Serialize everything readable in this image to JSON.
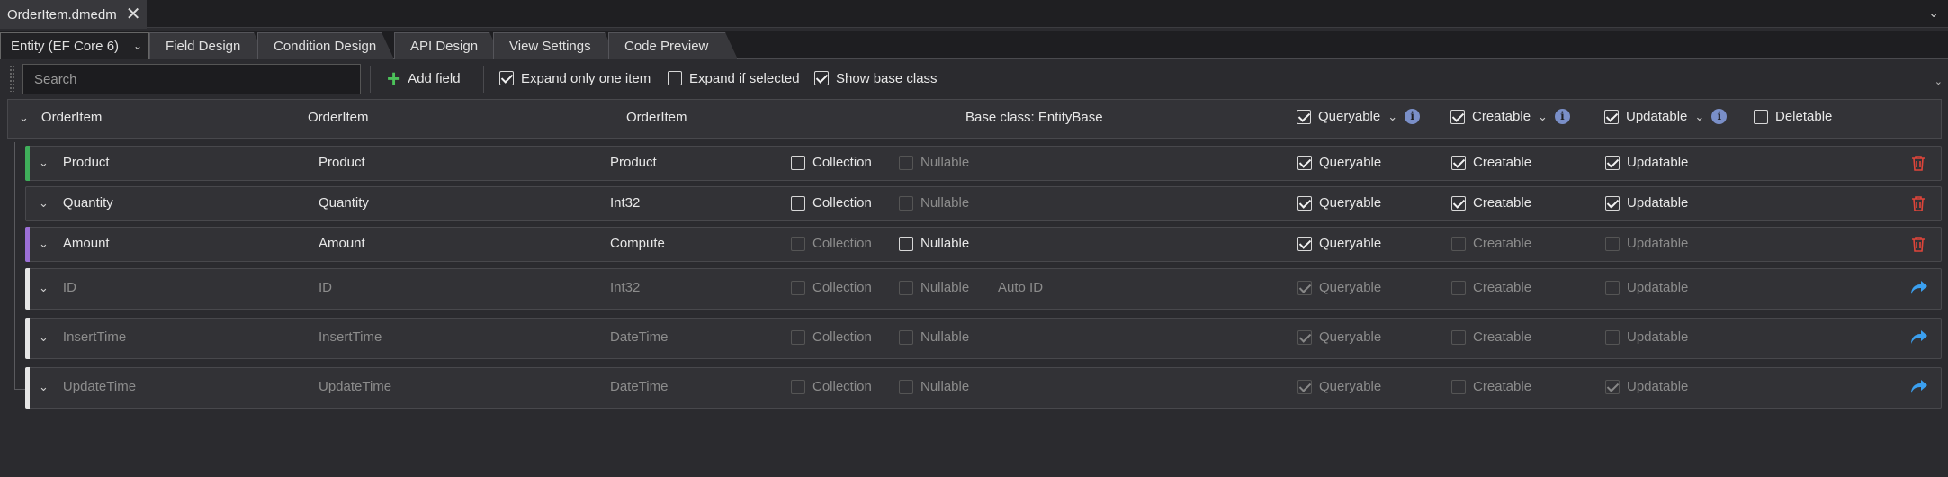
{
  "document_tab": {
    "title": "OrderItem.dmedm",
    "close_icon": "close-icon"
  },
  "tabs": [
    {
      "label": "Entity (EF Core 6)",
      "dropdown": "chevron-down-icon",
      "active": true
    },
    {
      "label": "Field Design"
    },
    {
      "label": "Condition Design"
    },
    {
      "label": "API Design"
    },
    {
      "label": "View Settings"
    },
    {
      "label": "Code Preview"
    }
  ],
  "toolbar": {
    "search_placeholder": "Search",
    "add_field_label": "Add field",
    "expand_only_one_label": "Expand only one item",
    "expand_only_one_checked": true,
    "expand_if_selected_label": "Expand if selected",
    "expand_if_selected_checked": false,
    "show_base_class_label": "Show base class",
    "show_base_class_checked": true
  },
  "entity": {
    "name": "OrderItem",
    "display_name": "OrderItem",
    "table_name": "OrderItem",
    "base_class_text": "Base class: EntityBase",
    "queryable_label": "Queryable",
    "creatable_label": "Creatable",
    "updatable_label": "Updatable",
    "deletable_label": "Deletable"
  },
  "labels": {
    "collection": "Collection",
    "nullable": "Nullable",
    "queryable": "Queryable",
    "creatable": "Creatable",
    "updatable": "Updatable"
  },
  "fields": [
    {
      "name": "Product",
      "display": "Product",
      "type": "Product",
      "stripe": "#3fae5a",
      "dim": false,
      "extra": "",
      "collection": false,
      "nullable": false,
      "nullable_enabled": false,
      "queryable": true,
      "creatable": true,
      "updatable": true,
      "creatable_enabled": true,
      "updatable_enabled": true,
      "action": "trash-icon"
    },
    {
      "name": "Quantity",
      "display": "Quantity",
      "type": "Int32",
      "stripe": "",
      "dim": false,
      "extra": "",
      "collection": false,
      "nullable": false,
      "nullable_enabled": false,
      "queryable": true,
      "creatable": true,
      "updatable": true,
      "creatable_enabled": true,
      "updatable_enabled": true,
      "action": "trash-icon"
    },
    {
      "name": "Amount",
      "display": "Amount",
      "type": "Compute",
      "stripe": "#9b6fd6",
      "dim": false,
      "extra": "",
      "collection": false,
      "collection_enabled": false,
      "nullable": false,
      "nullable_enabled": true,
      "queryable": true,
      "creatable": false,
      "updatable": false,
      "creatable_enabled": false,
      "updatable_enabled": false,
      "action": "trash-icon"
    },
    {
      "name": "ID",
      "display": "ID",
      "type": "Int32",
      "stripe": "#e6e6e6",
      "dim": true,
      "extra": "Auto ID",
      "collection": false,
      "nullable": false,
      "queryable": true,
      "creatable": false,
      "updatable": false,
      "action": "forward-icon"
    },
    {
      "name": "InsertTime",
      "display": "InsertTime",
      "type": "DateTime",
      "stripe": "#e6e6e6",
      "dim": true,
      "extra": "",
      "collection": false,
      "nullable": false,
      "queryable": true,
      "creatable": false,
      "updatable": false,
      "action": "forward-icon"
    },
    {
      "name": "UpdateTime",
      "display": "UpdateTime",
      "type": "DateTime",
      "stripe": "#e6e6e6",
      "dim": true,
      "extra": "",
      "collection": false,
      "nullable": false,
      "queryable": true,
      "creatable": false,
      "updatable": true,
      "action": "forward-icon"
    }
  ]
}
